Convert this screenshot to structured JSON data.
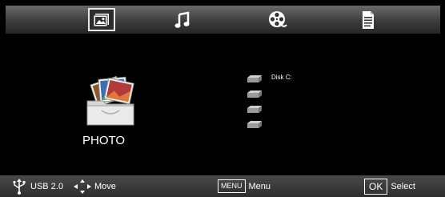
{
  "tabs": [
    {
      "icon": "photo-icon",
      "active": true
    },
    {
      "icon": "music-note-icon",
      "active": false
    },
    {
      "icon": "film-reel-icon",
      "active": false
    },
    {
      "icon": "document-icon",
      "active": false
    }
  ],
  "main": {
    "category_label": "PHOTO",
    "drives": [
      {
        "label": "Disk C:"
      },
      {
        "label": ""
      },
      {
        "label": ""
      },
      {
        "label": ""
      }
    ]
  },
  "footer": {
    "source_label": "USB 2.0",
    "move_label": "Move",
    "menu_key": "MENU",
    "menu_label": "Menu",
    "ok_key": "OK",
    "select_label": "Select"
  }
}
